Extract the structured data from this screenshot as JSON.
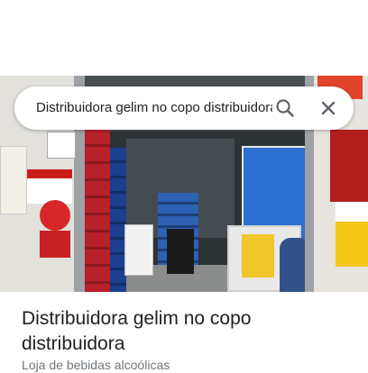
{
  "search": {
    "query": "Distribuidora gelim no copo distribuidora",
    "search_icon": "search-icon",
    "close_icon": "close-icon"
  },
  "place": {
    "title": "Distribuidora gelim no copo distribuidora",
    "category": "Loja de bebidas alcoólicas"
  },
  "photo": {
    "description_icon": "storefront-photo"
  },
  "colors": {
    "title_text": "#202124",
    "secondary_text": "#70757a",
    "icon_gray": "#5f6368"
  }
}
